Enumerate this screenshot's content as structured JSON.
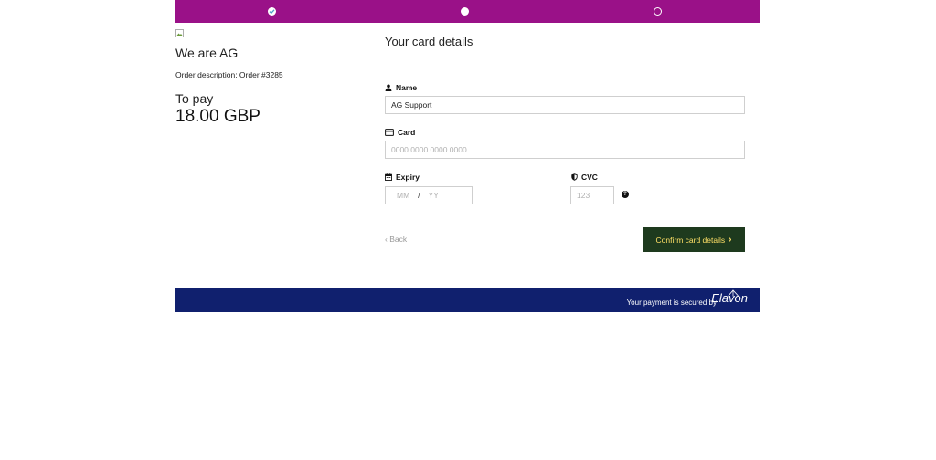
{
  "progress": {
    "steps": [
      {
        "state": "done"
      },
      {
        "state": "current"
      },
      {
        "state": "upcoming"
      }
    ],
    "color": "#9a1188"
  },
  "merchant": {
    "name": "We are AG",
    "order_description": "Order description: Order #3285",
    "to_pay_label": "To pay",
    "amount": "18.00 GBP"
  },
  "form": {
    "title": "Your card details",
    "name_label": "Name",
    "name_value": "AG Support",
    "card_label": "Card",
    "card_placeholder": "0000 0000 0000 0000",
    "expiry_label": "Expiry",
    "expiry_mm_placeholder": "MM",
    "expiry_separator": "/",
    "expiry_yy_placeholder": "YY",
    "cvc_label": "CVC",
    "cvc_placeholder": "123",
    "help_symbol": "?"
  },
  "actions": {
    "back_label": "Back",
    "confirm_label": "Confirm card details",
    "confirm_bg": "#1e3a1e",
    "confirm_text_color": "#ffe066"
  },
  "footer": {
    "secured_text": "Your payment is secured by",
    "brand": "Elavon",
    "bg": "#10206e"
  }
}
